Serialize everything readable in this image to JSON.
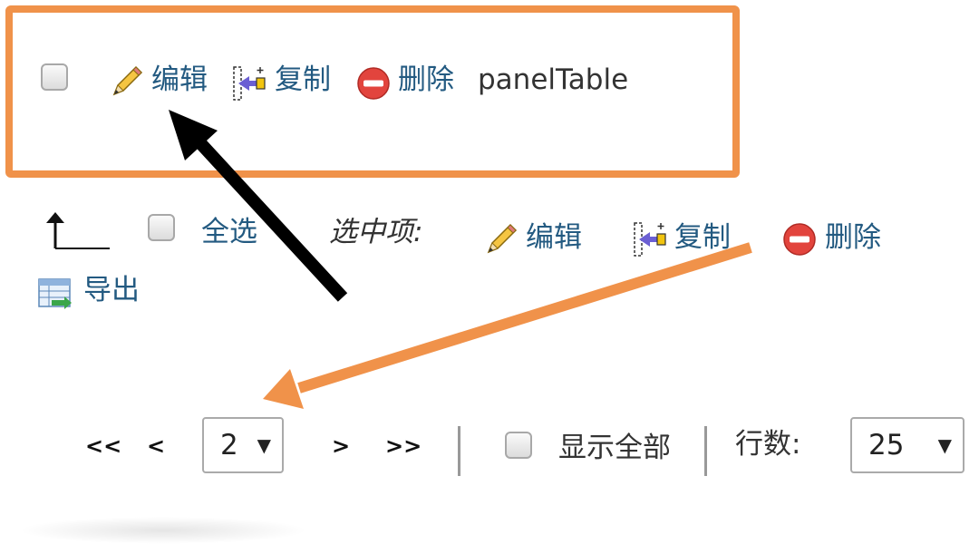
{
  "row": {
    "edit_label": "编辑",
    "copy_label": "复制",
    "delete_label": "删除",
    "table_name": "panelTable"
  },
  "bulk": {
    "select_all_label": "全选",
    "with_selected_label": "选中项:",
    "edit_label": "编辑",
    "copy_label": "复制",
    "delete_label": "删除",
    "export_label": "导出"
  },
  "pagination": {
    "first_label": "<<",
    "prev_label": "<",
    "current_page": "2",
    "next_label": ">",
    "last_label": ">>",
    "show_all_label": "显示全部",
    "rows_label": "行数:",
    "rows_value": "25"
  },
  "colors": {
    "highlight_orange": "#f0924a",
    "link_blue": "#235a81",
    "arrow_black": "#000000"
  }
}
